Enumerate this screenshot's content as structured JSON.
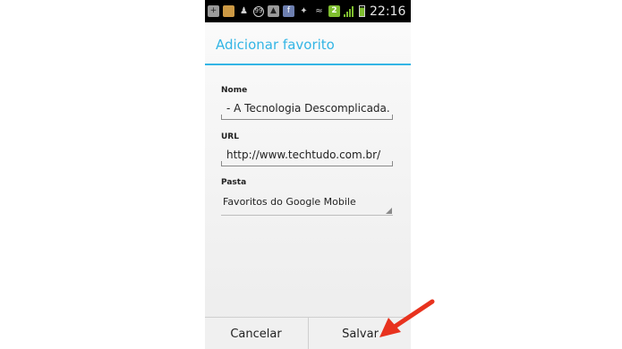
{
  "status_bar": {
    "icons": [
      "add-icon",
      "app-icon",
      "contact-icon",
      "notification-99-icon",
      "image-icon",
      "facebook-icon",
      "twitter-icon",
      "wifi-icon",
      "calendar-icon",
      "signal-icon",
      "battery-icon"
    ],
    "badge_99": "99",
    "badge_2": "2",
    "time": "22:16"
  },
  "dialog": {
    "title": "Adicionar favorito",
    "name_label": "Nome",
    "name_value": "- A Tecnologia Descomplicada.",
    "url_label": "URL",
    "url_value": "http://www.techtudo.com.br/",
    "folder_label": "Pasta",
    "folder_value": "Favoritos do Google Mobile"
  },
  "buttons": {
    "cancel": "Cancelar",
    "save": "Salvar"
  },
  "colors": {
    "accent": "#33b5e5",
    "annotation_arrow": "#e8321e"
  }
}
